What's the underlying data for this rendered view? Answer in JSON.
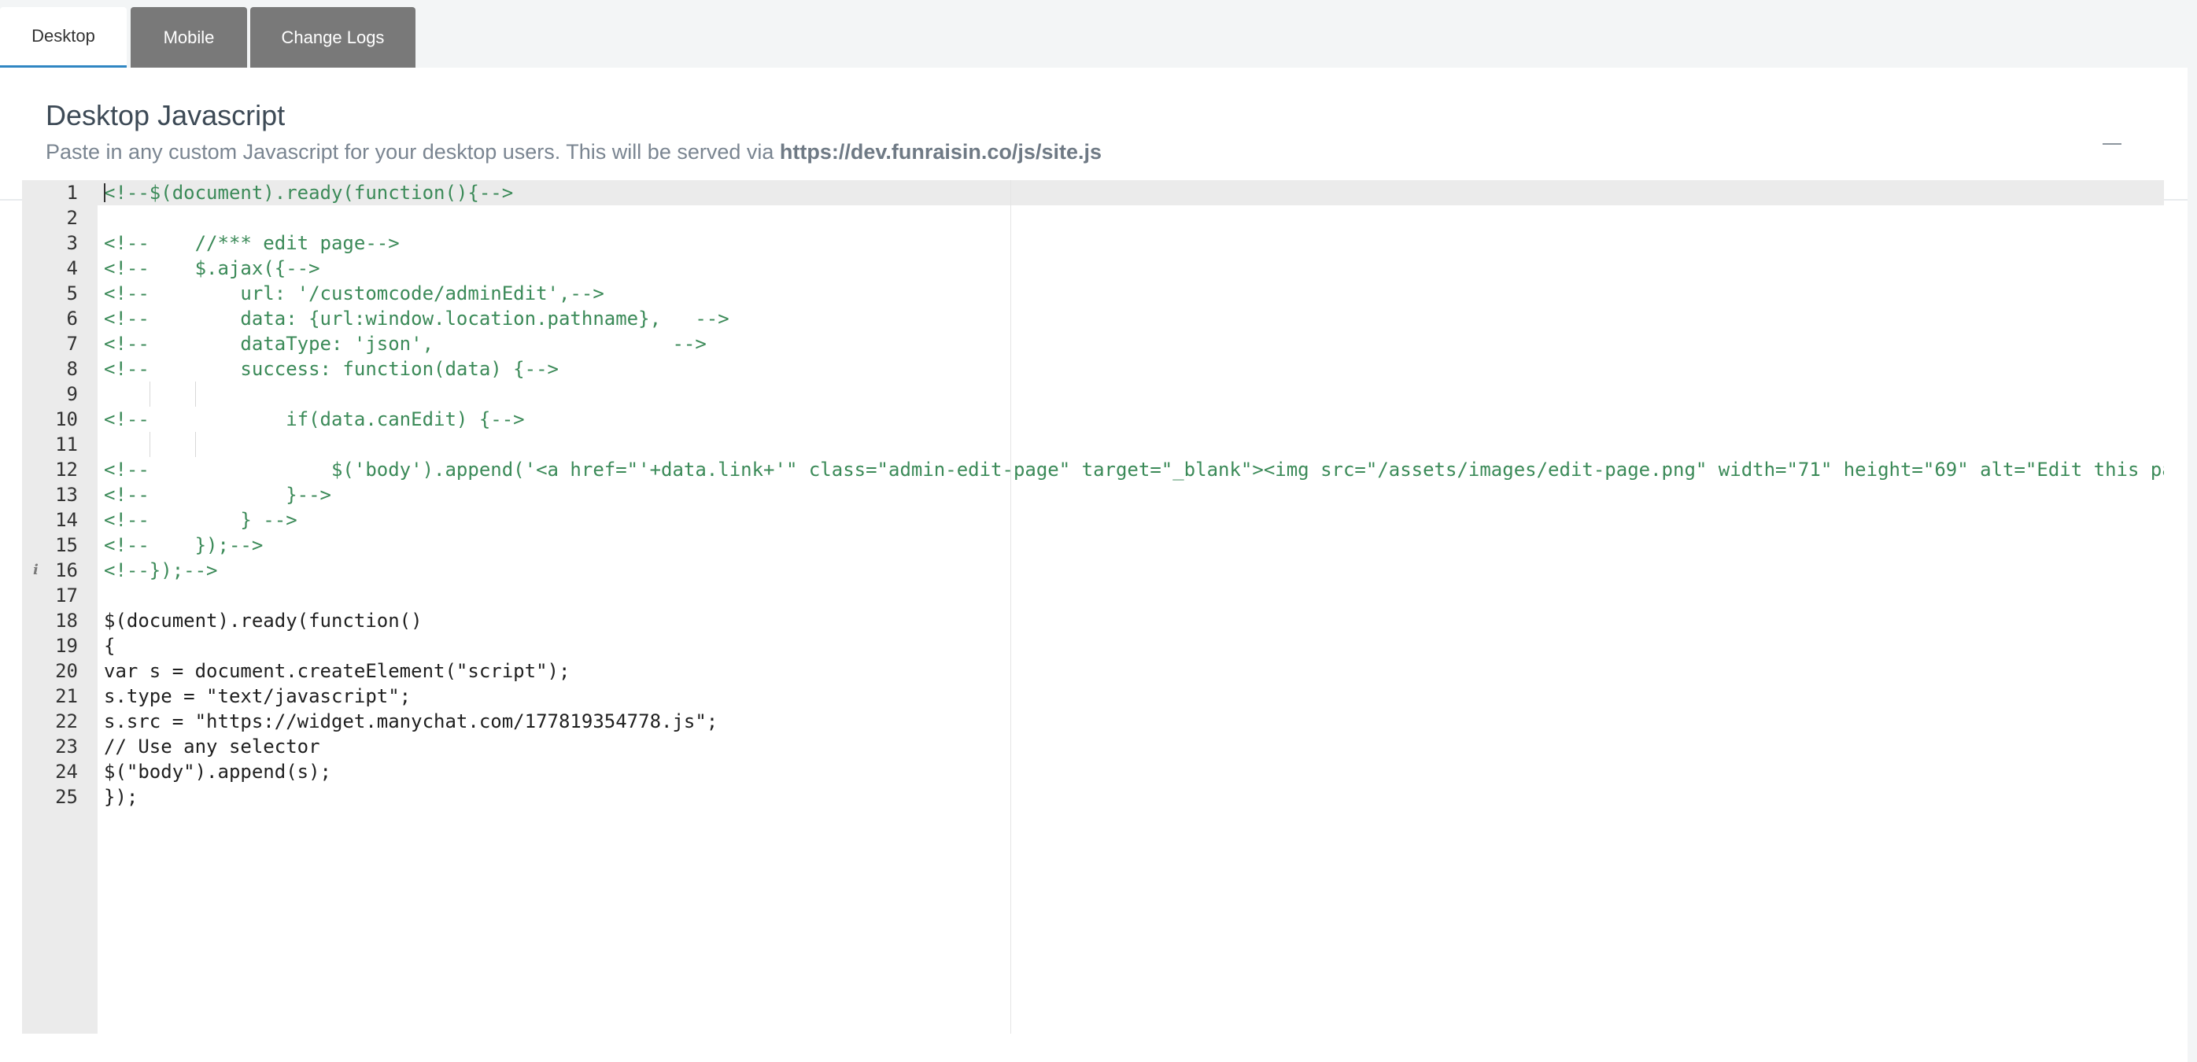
{
  "tabs": [
    {
      "label": "Desktop",
      "active": true
    },
    {
      "label": "Mobile",
      "active": false
    },
    {
      "label": "Change Logs",
      "active": false
    }
  ],
  "panel": {
    "title": "Desktop Javascript",
    "description_prefix": "Paste in any custom Javascript for your desktop users. This will be served via ",
    "description_url": "https://dev.funraisin.co/js/site.js",
    "collapse_icon": "minus-icon"
  },
  "editor": {
    "active_line": 1,
    "info_line": 16,
    "colors": {
      "comment": "#3b8a58",
      "text": "#1f1f1f",
      "gutter": "#ebebeb"
    },
    "lines": [
      {
        "n": "1",
        "text": "<!--$(document).ready(function(){-->",
        "comment": true
      },
      {
        "n": "2",
        "text": "",
        "comment": false
      },
      {
        "n": "3",
        "text": "<!--    //*** edit page-->",
        "comment": true
      },
      {
        "n": "4",
        "text": "<!--    $.ajax({-->",
        "comment": true
      },
      {
        "n": "5",
        "text": "<!--        url: '/customcode/adminEdit',-->",
        "comment": true
      },
      {
        "n": "6",
        "text": "<!--        data: {url:window.location.pathname},   -->",
        "comment": true
      },
      {
        "n": "7",
        "text": "<!--        dataType: 'json',                     -->",
        "comment": true
      },
      {
        "n": "8",
        "text": "<!--        success: function(data) {-->",
        "comment": true
      },
      {
        "n": "9",
        "text": "",
        "comment": false,
        "guides": true
      },
      {
        "n": "10",
        "text": "<!--            if(data.canEdit) {-->",
        "comment": true
      },
      {
        "n": "11",
        "text": "",
        "comment": false,
        "guides": true
      },
      {
        "n": "12",
        "text": "<!--                $('body').append('<a href=\"'+data.link+'\" class=\"admin-edit-page\" target=\"_blank\"><img src=\"/assets/images/edit-page.png\" width=\"71\" height=\"69\" alt=\"Edit this pa",
        "comment": true
      },
      {
        "n": "13",
        "text": "<!--            }-->",
        "comment": true
      },
      {
        "n": "14",
        "text": "<!--        } -->",
        "comment": true
      },
      {
        "n": "15",
        "text": "<!--    });-->",
        "comment": true
      },
      {
        "n": "16",
        "text": "<!--});-->",
        "comment": true
      },
      {
        "n": "17",
        "text": "",
        "comment": false
      },
      {
        "n": "18",
        "text": "$(document).ready(function()",
        "comment": false
      },
      {
        "n": "19",
        "text": "{",
        "comment": false
      },
      {
        "n": "20",
        "text": "var s = document.createElement(\"script\");",
        "comment": false
      },
      {
        "n": "21",
        "text": "s.type = \"text/javascript\";",
        "comment": false
      },
      {
        "n": "22",
        "text": "s.src = \"https://widget.manychat.com/177819354778.js\";",
        "comment": false
      },
      {
        "n": "23",
        "text": "// Use any selector",
        "comment": false
      },
      {
        "n": "24",
        "text": "$(\"body\").append(s);",
        "comment": false
      },
      {
        "n": "25",
        "text": "});",
        "comment": false
      }
    ]
  }
}
